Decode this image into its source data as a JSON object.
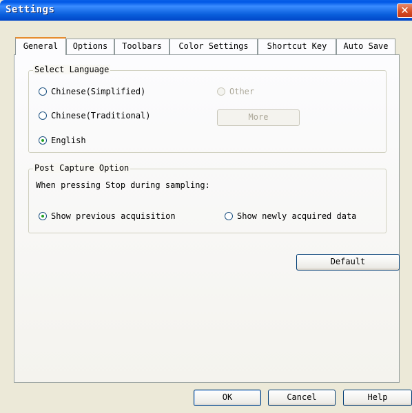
{
  "window": {
    "title": "Settings",
    "close_label": "✕"
  },
  "tabs": [
    {
      "label": "General",
      "active": true
    },
    {
      "label": "Options"
    },
    {
      "label": "Toolbars"
    },
    {
      "label": "Color Settings"
    },
    {
      "label": "Shortcut Key"
    },
    {
      "label": "Auto Save"
    }
  ],
  "language_group": {
    "legend": "Select Language",
    "options": [
      {
        "label": "Chinese(Simplified)",
        "checked": false
      },
      {
        "label": "Chinese(Traditional)",
        "checked": false
      },
      {
        "label": "English",
        "checked": true
      },
      {
        "label": "Other",
        "checked": false,
        "disabled": true
      }
    ],
    "more_button": "More"
  },
  "capture_group": {
    "legend": "Post Capture Option",
    "description": "When pressing Stop during sampling:",
    "options": [
      {
        "label": "Show previous acquisition",
        "checked": true
      },
      {
        "label": "Show newly acquired data",
        "checked": false
      }
    ]
  },
  "default_button": "Default",
  "footer": {
    "ok": "OK",
    "cancel": "Cancel",
    "help": "Help"
  }
}
